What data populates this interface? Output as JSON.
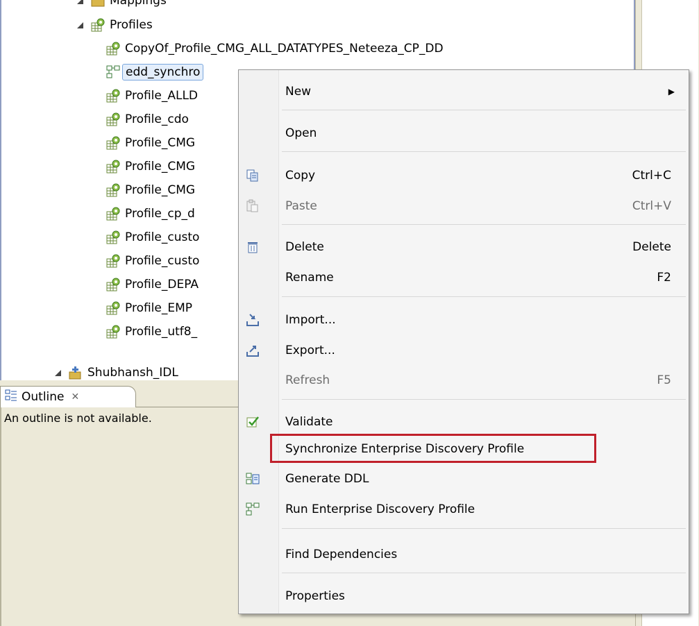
{
  "tree": {
    "mapping_label": "Mappings",
    "profiles_folder": "Profiles",
    "items": [
      "CopyOf_Profile_CMG_ALL_DATATYPES_Neteeza_CP_DD",
      "edd_synchro",
      "Profile_ALLD",
      "Profile_cdo",
      "Profile_CMG",
      "Profile_CMG",
      "Profile_CMG",
      "Profile_cp_d",
      "Profile_custo",
      "Profile_custo",
      "Profile_DEPA",
      "Profile_EMP",
      "Profile_utf8_"
    ],
    "project_label": "Shubhansh_IDL"
  },
  "outline": {
    "tab_label": "Outline",
    "close_glyph": "✕",
    "message": "An outline is not available."
  },
  "context_menu": {
    "items": {
      "new": "New",
      "open": "Open",
      "copy": "Copy",
      "copy_shortcut": "Ctrl+C",
      "paste": "Paste",
      "paste_shortcut": "Ctrl+V",
      "delete": "Delete",
      "delete_shortcut": "Delete",
      "rename": "Rename",
      "rename_shortcut": "F2",
      "import": "Import...",
      "export": "Export...",
      "refresh": "Refresh",
      "refresh_shortcut": "F5",
      "validate": "Validate",
      "synchronize": "Synchronize Enterprise Discovery Profile",
      "generate_ddl": "Generate DDL",
      "run_edp": "Run Enterprise Discovery Profile",
      "find_dependencies": "Find Dependencies",
      "properties": "Properties"
    },
    "submenu_arrow": "▶"
  },
  "colors": {
    "highlight_border": "#c0202b",
    "selection_bg": "#e4eefb",
    "panel_bg": "#ece9d8"
  }
}
